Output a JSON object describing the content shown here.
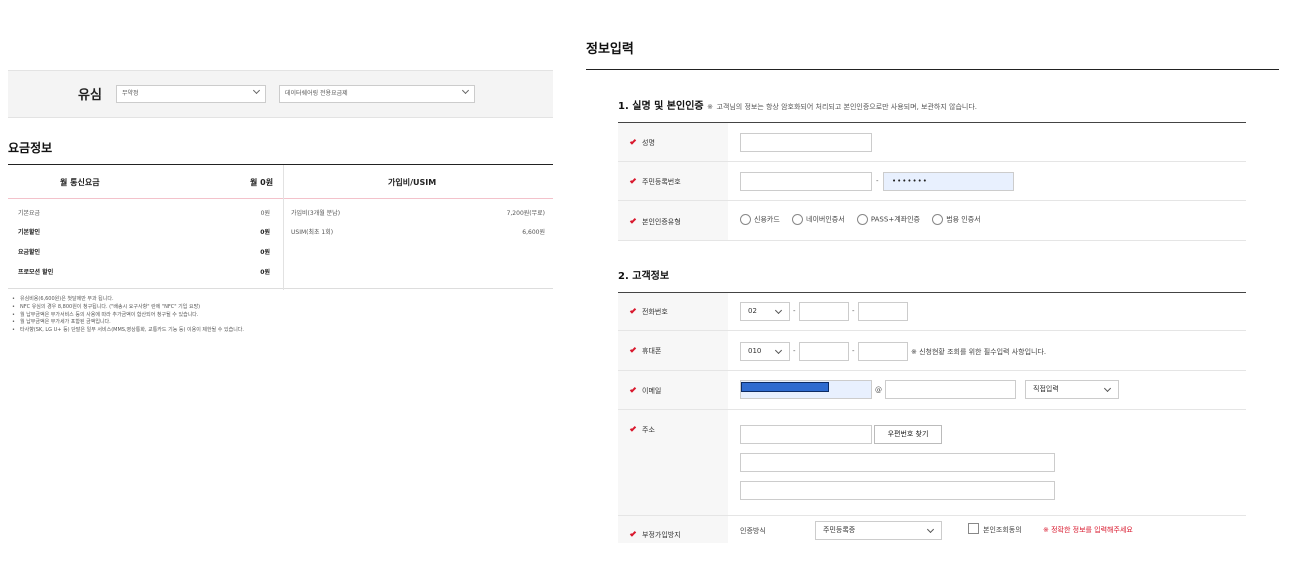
{
  "left": {
    "usim": {
      "title": "유심",
      "select1": "무약정",
      "select2": "데이터쉐어링 전용요금제"
    },
    "fee_info": {
      "heading": "요금정보",
      "col1_header": "월 통신요금",
      "col2_header": "월 0원",
      "col3_header": "가입비/USIM",
      "rows": [
        {
          "label": "기본요금",
          "value": "0원",
          "bold": false
        },
        {
          "label": "기본할인",
          "value": "0원",
          "bold": true
        },
        {
          "label": "요금할인",
          "value": "0원",
          "bold": true
        },
        {
          "label": "프로모션 할인",
          "value": "0원",
          "bold": true
        }
      ],
      "right_rows": [
        {
          "label": "가입비(3개월 분납)",
          "value": "7,200원(무료)"
        },
        {
          "label": "USIM(최초 1회)",
          "value": "6,600원"
        }
      ]
    },
    "notes": [
      "유심비용(6,600원)은 첫달에만 부과 됩니다.",
      "NFC 유심의 경우 8,800원이 청구됩니다. (\"배송시 요구사항\" 란에 \"NFC\" 기입 요망)",
      "월 납부금액은 부가서비스 등의 사용에 따라 추가금액이 합산되어 청구될 수 있습니다.",
      "월 납부금액은 부가세가 포함된 금액입니다.",
      "타사향(SK, LG U+ 등) 단말은 일부 서비스(MMS,영상통화, 교통카드 기능 등) 이용이 제한될 수 있습니다."
    ]
  },
  "right": {
    "title": "정보입력",
    "section1": {
      "title": "1. 실명 및 본인인증",
      "mark": "※",
      "subtitle": "고객님의 정보는 항상 암호화되어 처리되고 본인인증으로만 사용되며, 보관하지 않습니다.",
      "name_label": "성명",
      "rrn_label": "주민등록번호",
      "rrn_dash": "-",
      "rrn_mask": "•••••••",
      "auth_label": "본인인증유형",
      "auth_options": [
        "신용카드",
        "네이버인증서",
        "PASS+계좌인증",
        "범용 인증서"
      ]
    },
    "section2": {
      "title": "2. 고객정보",
      "phone_label": "전화번호",
      "phone_prefix": "02",
      "mobile_label": "휴대폰",
      "mobile_prefix": "010",
      "dash": "-",
      "mobile_notice": "※ 신청현황 조회를 위한 필수입력 사항입니다.",
      "email_label": "이메일",
      "email_at": "@",
      "email_domain_select": "직접입력",
      "address_label": "주소",
      "zipcode_button": "우편번호 찾기",
      "illegal_label": "부정가입방지",
      "auth_method_label": "인증방식",
      "auth_method_select": "주민등록증",
      "consent_label": "본인조회동의",
      "consent_warning": "※ 정확한 정보를 입력해주세요"
    }
  }
}
